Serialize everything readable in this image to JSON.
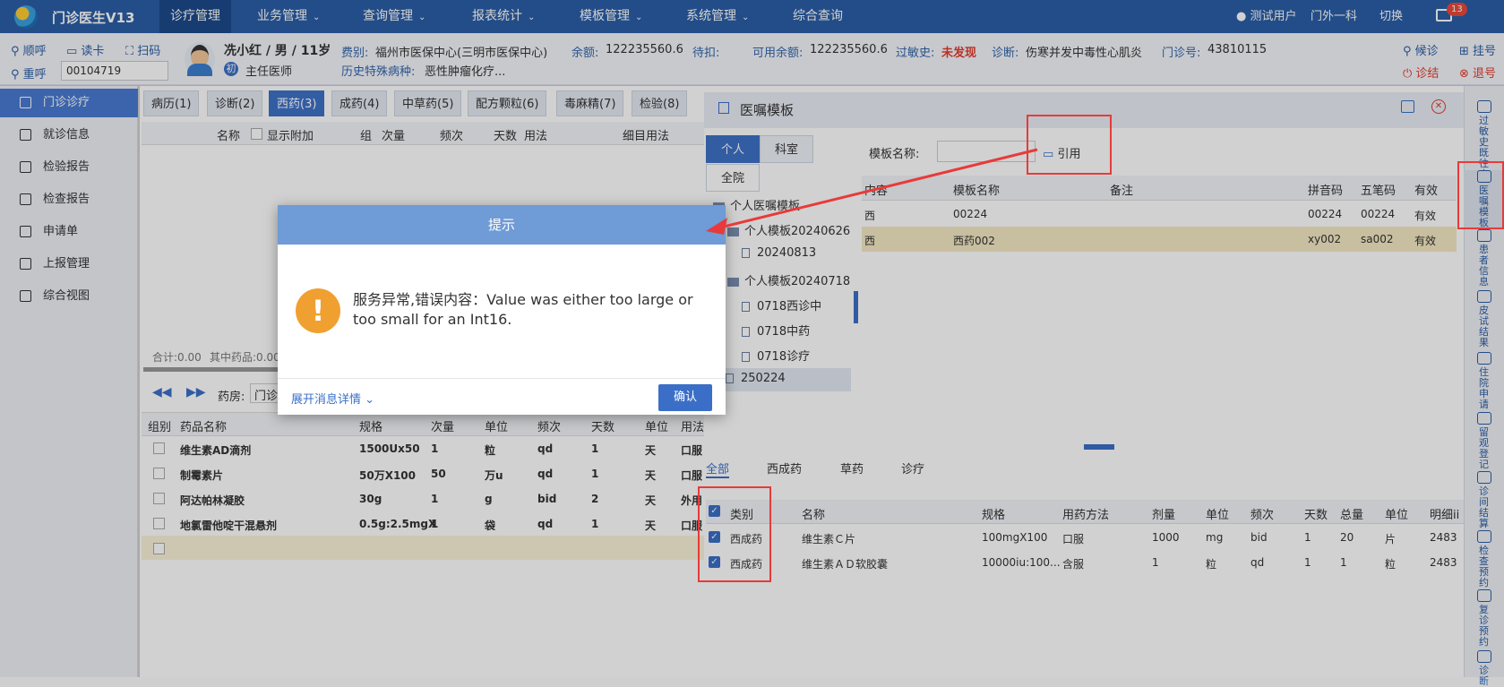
{
  "topbar": {
    "app": "门诊医生V13",
    "nav": [
      {
        "label": "诊疗管理",
        "chev": ""
      },
      {
        "label": "业务管理",
        "chev": "⌄"
      },
      {
        "label": "查询管理",
        "chev": "⌄"
      },
      {
        "label": "报表统计",
        "chev": "⌄"
      },
      {
        "label": "模板管理",
        "chev": "⌄"
      },
      {
        "label": "系统管理",
        "chev": "⌄"
      },
      {
        "label": "综合查询",
        "chev": ""
      }
    ],
    "user": "测试用户",
    "dept": "门外一科",
    "switch": "切换",
    "badge": "13"
  },
  "patient": {
    "actions": [
      "顺呼",
      "读卡",
      "扫码",
      "重呼"
    ],
    "id": "00104719",
    "name": "冼小红 / 男 / 11岁",
    "visit_tag": "初",
    "doctor": "主任医师",
    "fee_label": "费别:",
    "fee": "福州市医保中心(三明市医保中心)",
    "bal_label": "余额:",
    "bal": "122235560.6",
    "pend_label": "待扣:",
    "avail_label": "可用余额:",
    "avail": "122235560.6",
    "allergy_label": "过敏史:",
    "allergy": "未发现",
    "diag_label": "诊断:",
    "diag": "伤寒并发中毒性心肌炎",
    "no_label": "门诊号:",
    "no": "43810115",
    "special_label": "历史特殊病种:",
    "special": "恶性肿瘤化疗...",
    "right": [
      "候诊",
      "挂号",
      "诊结",
      "退号"
    ]
  },
  "sidebar": [
    "门诊诊疗",
    "就诊信息",
    "检验报告",
    "检查报告",
    "申请单",
    "上报管理",
    "综合视图"
  ],
  "tabs": [
    "病历(1)",
    "诊断(2)",
    "西药(3)",
    "成药(4)",
    "中草药(5)",
    "配方颗粒(6)",
    "毒麻精(7)",
    "检验(8)"
  ],
  "rx_header": {
    "name": "名称",
    "show": "显示附加",
    "group": "组",
    "dose": "次量",
    "freq": "频次",
    "days": "天数",
    "usage": "用法",
    "detail": "细目用法"
  },
  "rx_footer": {
    "total": "合计:0.00",
    "drug": "其中药品:0.00"
  },
  "pharmacy": {
    "label": "药房:",
    "value": "门诊"
  },
  "drug_cols": [
    "组别",
    "药品名称",
    "规格",
    "次量",
    "单位",
    "频次",
    "天数",
    "单位",
    "用法"
  ],
  "drugs": [
    [
      "维生素AD滴剂",
      "1500Ux50",
      "1",
      "粒",
      "qd",
      "1",
      "天",
      "口服"
    ],
    [
      "制霉素片",
      "50万X100",
      "50",
      "万u",
      "qd",
      "1",
      "天",
      "口服"
    ],
    [
      "阿达帕林凝胶",
      "30g",
      "1",
      "g",
      "bid",
      "2",
      "天",
      "外用"
    ],
    [
      "地氯雷他啶干混悬剂",
      "0.5g:2.5mgX",
      "1",
      "袋",
      "qd",
      "1",
      "天",
      "口服"
    ]
  ],
  "template": {
    "title": "医嘱模板",
    "scope_tabs": [
      "个人",
      "科室",
      "全院"
    ],
    "name_label": "模板名称:",
    "cite": "引用",
    "tree": [
      "个人医嘱模板",
      "个人模板20240626",
      "20240813",
      "个人模板20240718",
      "0718西诊中",
      "0718中药",
      "0718诊疗",
      "250224"
    ],
    "cols": [
      "内容",
      "模板名称",
      "备注",
      "拼音码",
      "五笔码",
      "有效"
    ],
    "rows": [
      [
        "西",
        "00224",
        "",
        "00224",
        "00224",
        "有效"
      ],
      [
        "西",
        "西药002",
        "",
        "xy002",
        "sa002",
        "有效"
      ]
    ],
    "filter_tabs": [
      "全部",
      "西成药",
      "草药",
      "诊疗"
    ],
    "item_cols": [
      "类别",
      "名称",
      "规格",
      "用药方法",
      "剂量",
      "单位",
      "频次",
      "天数",
      "总量",
      "单位",
      "明细ii"
    ],
    "items": [
      [
        "西成药",
        "维生素Ｃ片",
        "100mgX100",
        "口服",
        "1000",
        "mg",
        "bid",
        "1",
        "20",
        "片",
        "2483"
      ],
      [
        "西成药",
        "维生素ＡＤ软胶囊",
        "10000iu:100...",
        "含服",
        "1",
        "粒",
        "qd",
        "1",
        "1",
        "粒",
        "2483"
      ]
    ]
  },
  "rightbar": [
    "过敏史既往史",
    "医嘱模板",
    "患者信息",
    "皮试结果",
    "住院申请",
    "留观登记",
    "诊间结算",
    "检查预约",
    "复诊预约",
    "诊断"
  ],
  "dialog": {
    "title": "提示",
    "message": "服务异常,错误内容：Value was either too large or too small for an Int16.",
    "expand": "展开消息详情",
    "ok": "确认"
  }
}
